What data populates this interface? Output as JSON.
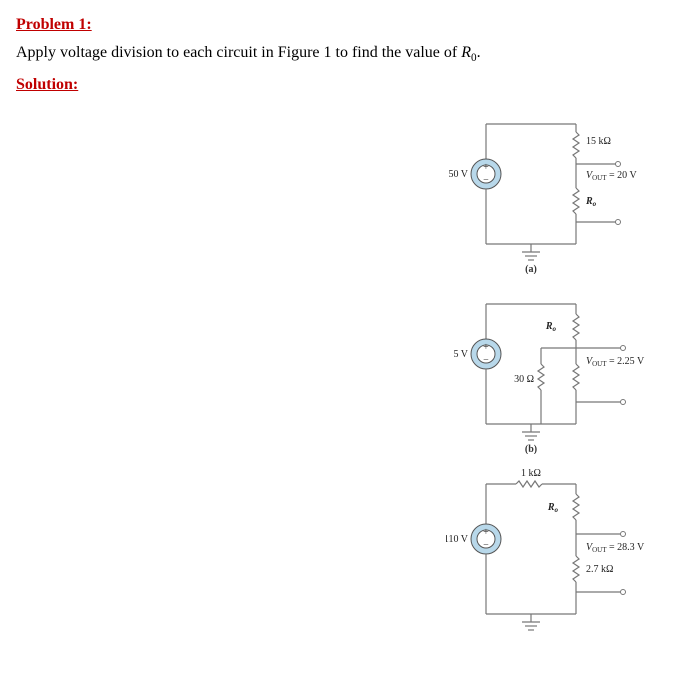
{
  "problem": {
    "title": "Problem 1:",
    "prompt_pre": "Apply voltage division to each circuit in Figure 1 to find the value of ",
    "prompt_var": "R",
    "prompt_sub": "0",
    "prompt_post": "."
  },
  "solution_title": "Solution:",
  "circuits": {
    "a": {
      "source": "50 V",
      "r_top": "15 kΩ",
      "r_aux_prefix": "R",
      "r_aux_sub": "o",
      "vout_prefix": "V",
      "vout_sub": "OUT",
      "vout_val": " = 20 V",
      "caption": "(a)"
    },
    "b": {
      "source": "5 V",
      "r_aux_prefix": "R",
      "r_aux_sub": "o",
      "r_left": "30 Ω",
      "vout_prefix": "V",
      "vout_sub": "OUT",
      "vout_val": " = 2.25 V",
      "caption": "(b)"
    },
    "c": {
      "source": "110 V",
      "r_top": "1 kΩ",
      "r_aux_prefix": "R",
      "r_aux_sub": "o",
      "vout_prefix": "V",
      "vout_sub": "OUT",
      "vout_val": " = 28.3 V",
      "r_out": "2.7 kΩ",
      "caption": ""
    }
  }
}
